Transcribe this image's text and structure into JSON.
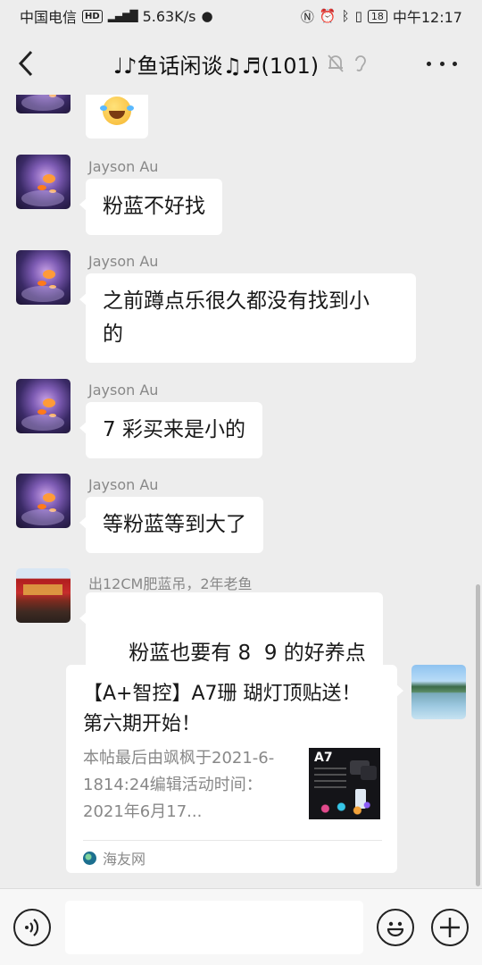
{
  "status_bar": {
    "carrier": "中国电信",
    "hd_badge": "HD",
    "network": "4G",
    "speed": "5.63K/s",
    "battery": "18",
    "time": "中午12:17"
  },
  "header": {
    "title": "♩♪鱼话闲谈♫♬(101)",
    "icons": [
      "back-icon",
      "mute-bell-icon",
      "ear-icon",
      "more-icon"
    ]
  },
  "messages": [
    {
      "sender": "Jayson Au",
      "text": "粉蓝不好找"
    },
    {
      "sender": "Jayson Au",
      "text_line1": "之前蹲点乐很久都没有找到小",
      "text_line2": "的"
    },
    {
      "sender": "Jayson Au",
      "text": "7 彩买来是小的"
    },
    {
      "sender": "Jayson Au",
      "text": "等粉蓝等到大了"
    },
    {
      "sender": "出12CM肥蓝吊，2年老鱼",
      "text": "粉蓝也要有 8  9 的好养点"
    }
  ],
  "link_card": {
    "title": "【A+智控】A7珊 瑚灯顶贴送！ 第六期开始！",
    "description": "本帖最后由飒枫于2021-6-1814:24编辑活动时间：2021年6月17...",
    "thumb_label": "A7",
    "source": "海友网"
  },
  "input_bar": {
    "placeholder": "",
    "icons": [
      "voice-icon",
      "emoji-icon",
      "plus-icon"
    ]
  }
}
